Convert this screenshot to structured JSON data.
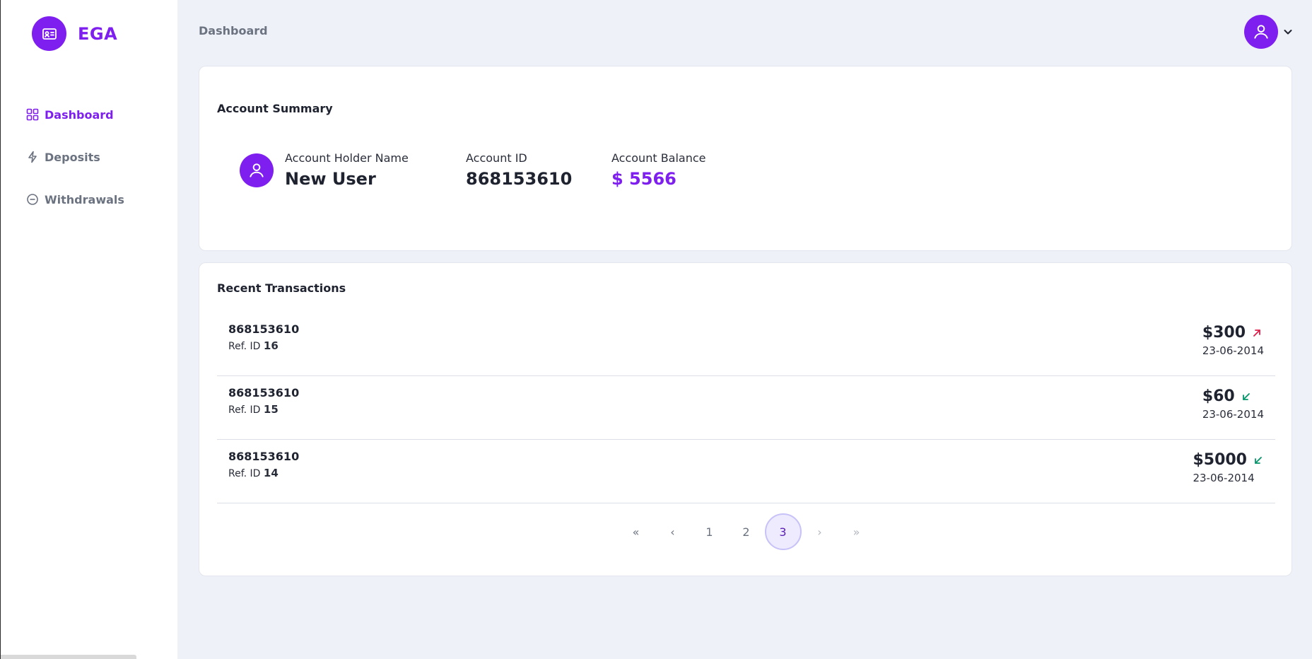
{
  "app": {
    "brand": "EGA",
    "brand_color": "#7e1ff0"
  },
  "sidebar": {
    "items": [
      {
        "label": "Dashboard",
        "icon": "grid-icon",
        "active": true
      },
      {
        "label": "Deposits",
        "icon": "lightning-icon",
        "active": false
      },
      {
        "label": "Withdrawals",
        "icon": "minus-circle-icon",
        "active": false
      }
    ]
  },
  "header": {
    "title": "Dashboard",
    "user_icon": "user-icon"
  },
  "summary": {
    "title": "Account Summary",
    "holder_label": "Account Holder Name",
    "holder_name": "New User",
    "account_id_label": "Account ID",
    "account_id": "868153610",
    "balance_label": "Account Balance",
    "balance": "$ 5566"
  },
  "transactions": {
    "title": "Recent Transactions",
    "ref_prefix": "Ref. ID",
    "rows": [
      {
        "account": "868153610",
        "ref": "16",
        "amount": "$300",
        "direction": "out",
        "date": "23-06-2014"
      },
      {
        "account": "868153610",
        "ref": "15",
        "amount": "$60",
        "direction": "in",
        "date": "23-06-2014"
      },
      {
        "account": "868153610",
        "ref": "14",
        "amount": "$5000",
        "direction": "in",
        "date": "23-06-2014"
      }
    ],
    "colors": {
      "out": "#e11d48",
      "in": "#059669"
    }
  },
  "pagination": {
    "first": "«",
    "prev": "‹",
    "pages": [
      "1",
      "2",
      "3"
    ],
    "current": "3",
    "next": "›",
    "last": "»"
  }
}
